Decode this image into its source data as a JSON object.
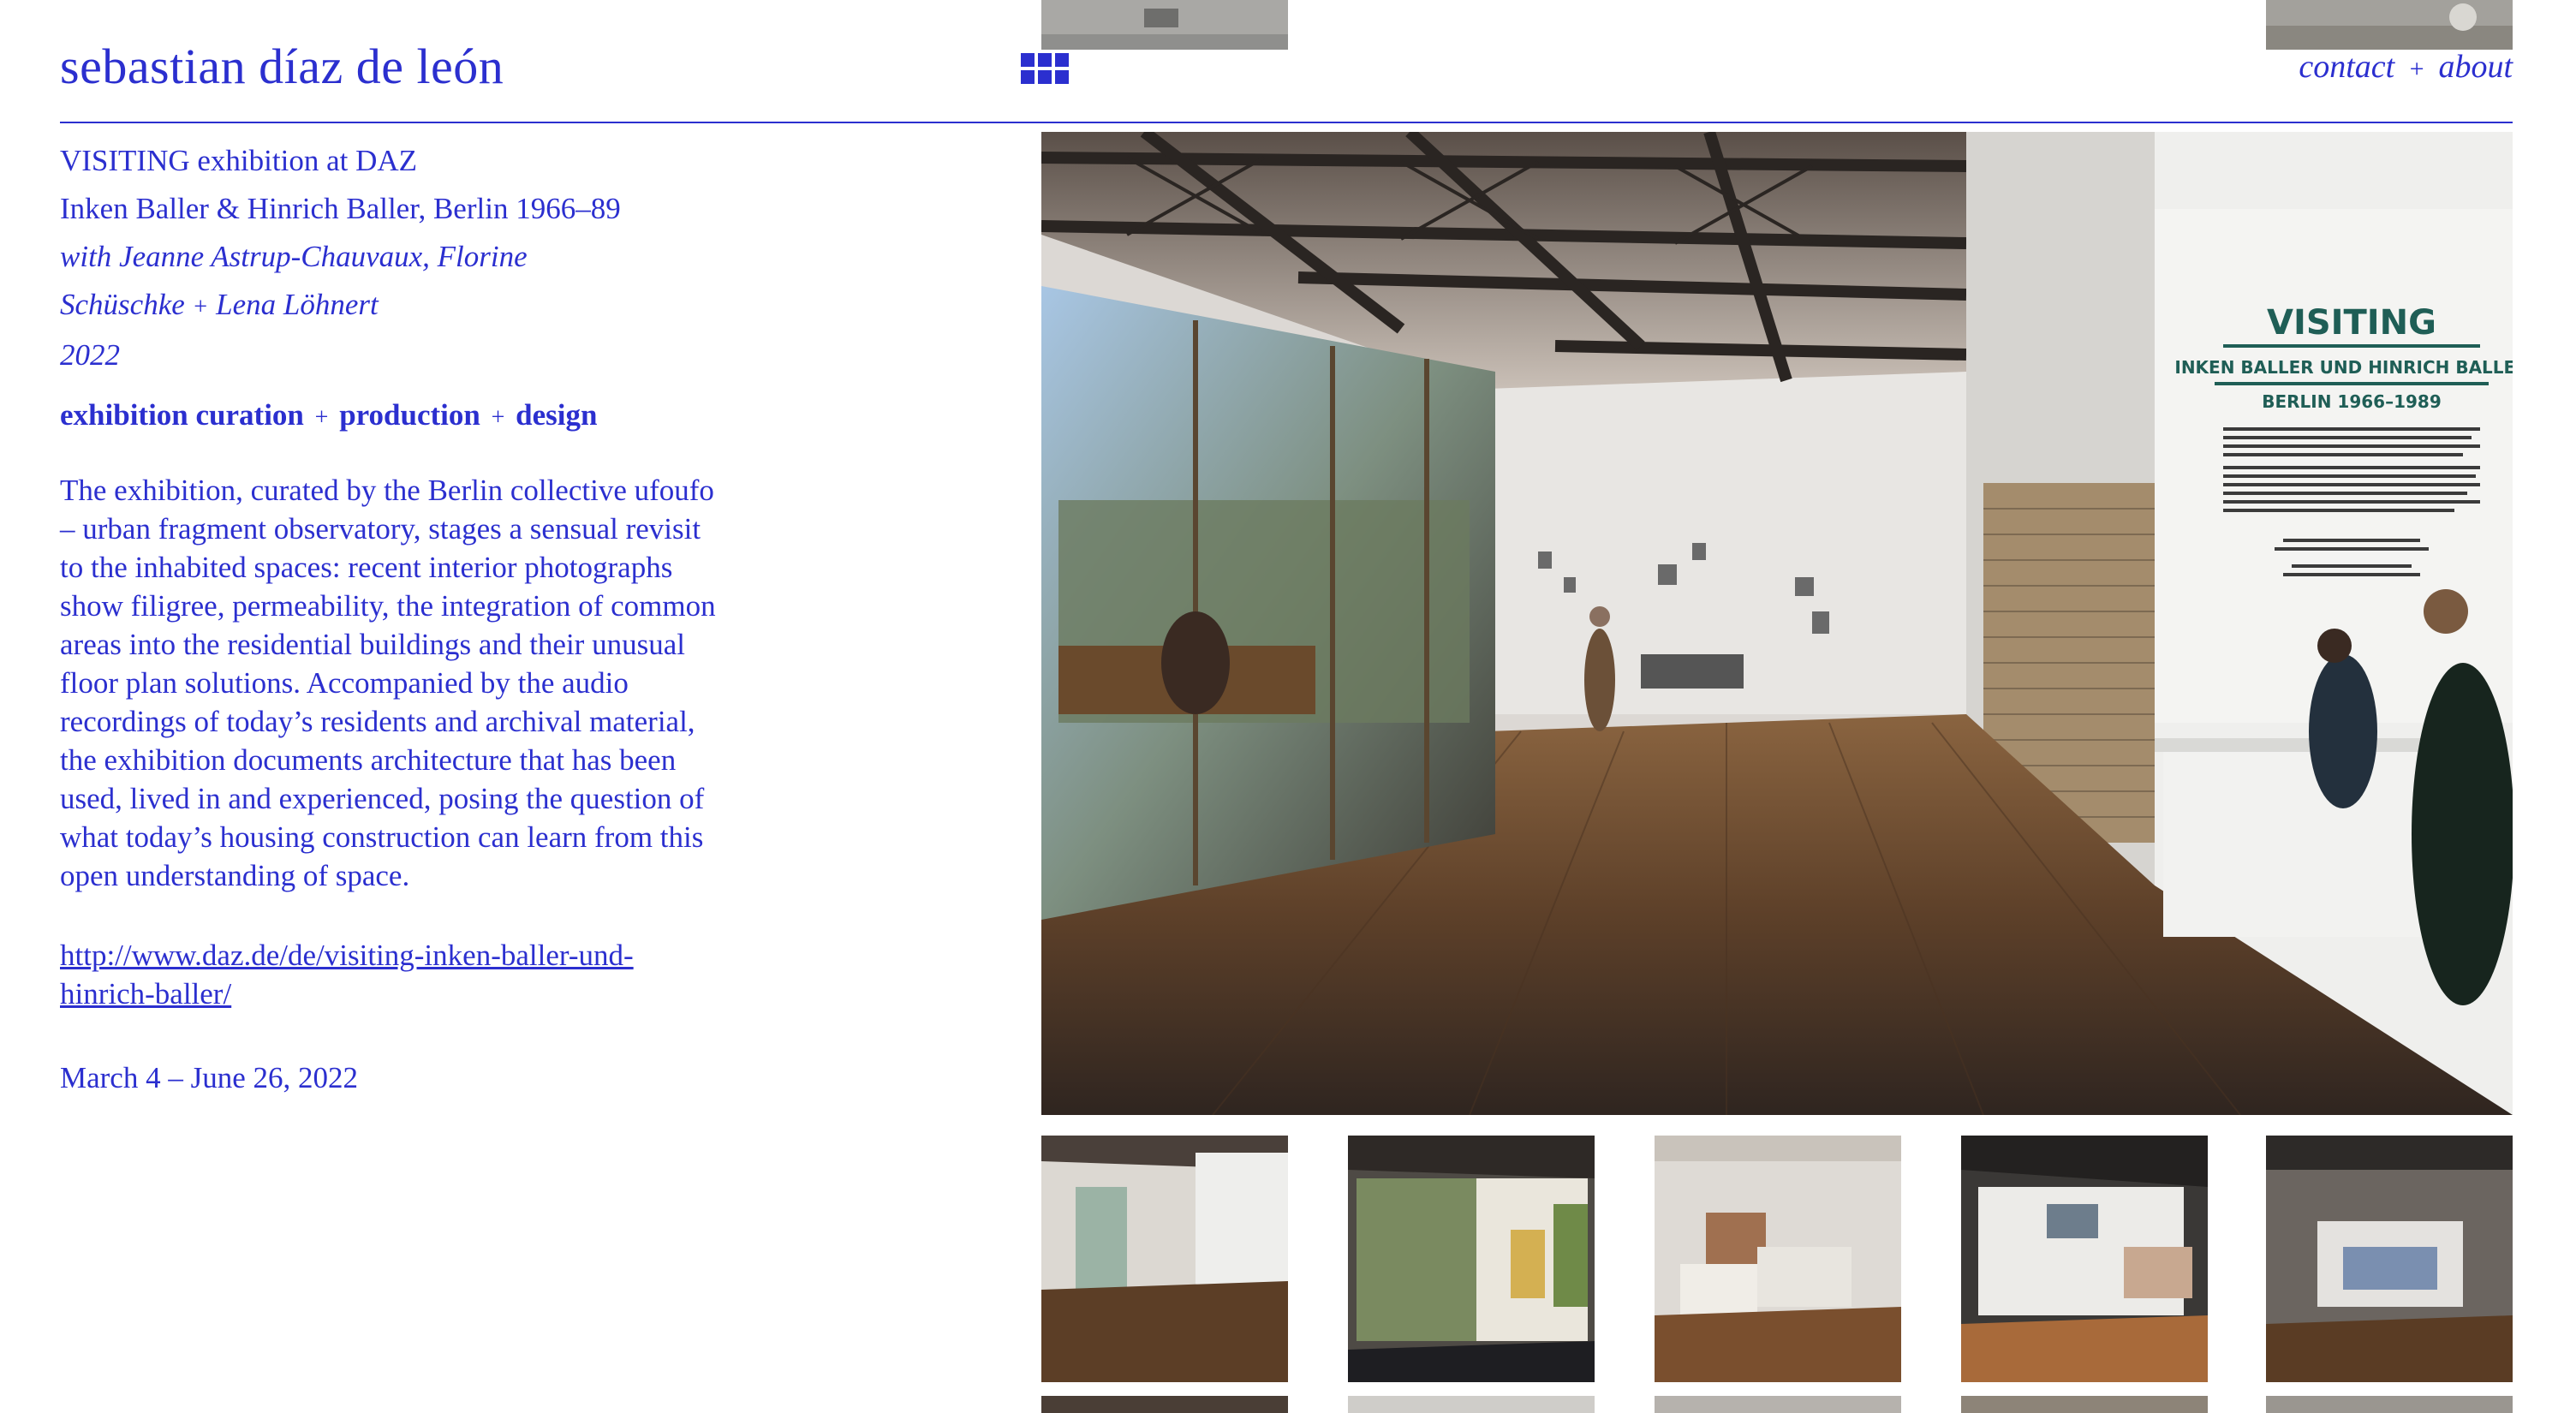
{
  "header": {
    "site_title": "sebastian díaz de león",
    "nav": {
      "contact": "contact",
      "separator": "+",
      "about": "about"
    },
    "grid_icon": "grid-icon"
  },
  "project": {
    "title_line1": "VISITING exhibition at DAZ",
    "title_line2": "Inken Baller & Hinrich Baller, Berlin 1966–89",
    "credits_line1": "with Jeanne Astrup-Chauvaux, Florine",
    "credits_line2": "Schüschke",
    "credits_plus": "+",
    "credits_line2b": "Lena Löhnert",
    "year": "2022",
    "roles": [
      "exhibition curation",
      "production",
      "design"
    ],
    "roles_plus": "+",
    "description": "The exhibition, curated by the Berlin collective ufoufo – urban fragment observatory, stages a sensual revisit to the inhabited spaces: recent interior photographs show filigree, permeability, the integration of common areas into the residential buildings and their unusual floor plan solutions. Accompanied by the audio recordings of today’s residents and archival material, the exhibition documents architecture that has been used, lived in and experienced, posing the question of what today’s housing construction can learn from this open understanding of space.",
    "link": "http://www.daz.de/de/visiting-inken-baller-und-hinrich-baller/",
    "dates": "March 4 – June 26, 2022"
  },
  "main_image": {
    "wall_title": "VISITING",
    "wall_subtitle": "INKEN BALLER UND HINRICH BALLER",
    "wall_years": "BERLIN 1966–1989"
  },
  "colors": {
    "accent": "#2b2fcf",
    "floor": "#6b4a2e",
    "wall": "#e9e6e2",
    "teal": "#1f5e56"
  }
}
